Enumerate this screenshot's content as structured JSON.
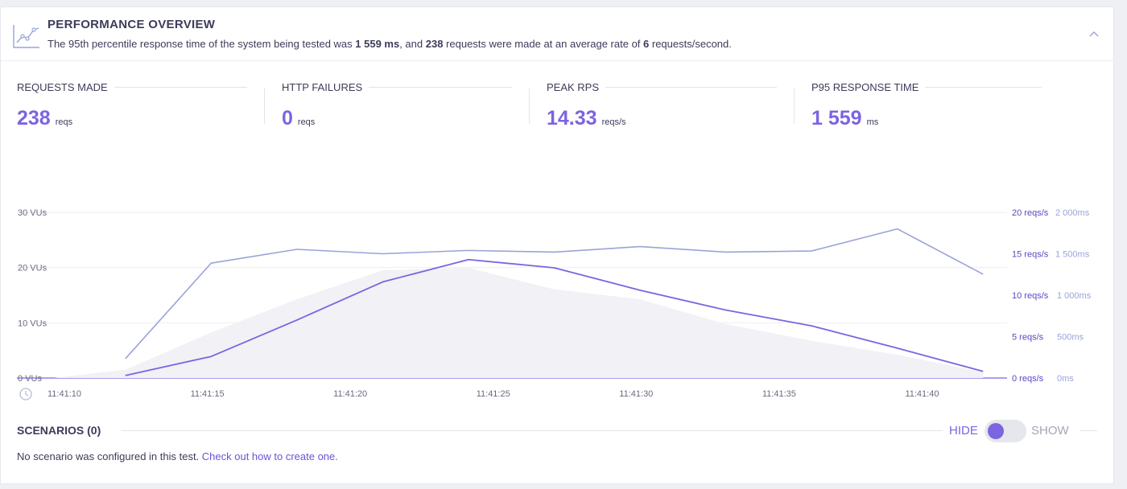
{
  "header": {
    "title": "PERFORMANCE OVERVIEW",
    "summary_prefix": "The 95th percentile response time of the system being tested was ",
    "p95_text": "1 559 ms",
    "summary_mid1": ", and ",
    "requests_text": "238",
    "summary_mid2": " requests were made at an average rate of ",
    "avg_rate_text": "6",
    "summary_suffix": " requests/second."
  },
  "metrics": [
    {
      "label": "REQUESTS MADE",
      "value": "238",
      "unit": "reqs"
    },
    {
      "label": "HTTP FAILURES",
      "value": "0",
      "unit": "reqs"
    },
    {
      "label": "PEAK RPS",
      "value": "14.33",
      "unit": "reqs/s"
    },
    {
      "label": "P95 RESPONSE TIME",
      "value": "1 559",
      "unit": "ms"
    }
  ],
  "colors": {
    "accent": "#7d64e0",
    "vus_line": "#9aa3d8",
    "area_fill": "#f1f1f6",
    "text": "#3c3c5a"
  },
  "chart_data": {
    "type": "line",
    "x_ticks": [
      "11:41:10",
      "11:41:15",
      "11:41:20",
      "11:41:25",
      "11:41:30",
      "11:41:35",
      "11:41:40"
    ],
    "y_left": {
      "ticks": [
        "0 VUs",
        "10 VUs",
        "20 VUs",
        "30 VUs"
      ],
      "range": [
        0,
        30
      ]
    },
    "y_right_rps": {
      "ticks": [
        "0 reqs/s",
        "5 reqs/s",
        "10 reqs/s",
        "15 reqs/s",
        "20 reqs/s"
      ],
      "range": [
        0,
        20
      ]
    },
    "y_right_ms": {
      "ticks": [
        "0ms",
        "500ms",
        "1 000ms",
        "1 500ms",
        "2 000ms"
      ],
      "range": [
        0,
        2000
      ]
    },
    "x_range_seconds": [
      0,
      33
    ],
    "series": [
      {
        "axis": "vus",
        "style": "line",
        "color": "#9aa3d8",
        "x": [
          2.5,
          5.5,
          8.5,
          11.5,
          14.5,
          17.5,
          20.5,
          23.5,
          26.5,
          29.5,
          32.5
        ],
        "y": [
          3.5,
          20.8,
          23.3,
          22.5,
          23.1,
          22.8,
          23.8,
          22.8,
          23.0,
          27.0,
          18.8
        ]
      },
      {
        "axis": "rps",
        "style": "line",
        "color": "#7d64e0",
        "x": [
          2.5,
          5.5,
          8.5,
          11.5,
          14.5,
          17.5,
          20.5,
          23.5,
          26.5,
          29.5,
          32.5
        ],
        "y": [
          0.3,
          2.6,
          7.0,
          11.6,
          14.3,
          13.3,
          10.6,
          8.2,
          6.3,
          3.6,
          0.8
        ]
      },
      {
        "axis": "ms",
        "style": "area",
        "color": "#f1f1f6",
        "x": [
          0,
          2.5,
          5.5,
          8.5,
          11.5,
          14.5,
          17.5,
          20.5,
          23.5,
          26.5,
          29.5,
          32.5
        ],
        "y": [
          0,
          100,
          550,
          950,
          1300,
          1330,
          1070,
          950,
          650,
          450,
          280,
          70
        ]
      }
    ]
  },
  "scenarios": {
    "title": "SCENARIOS (0)",
    "hide_label": "HIDE",
    "show_label": "SHOW",
    "empty_text": "No scenario was configured in this test. ",
    "link_text": "Check out how to create one."
  }
}
